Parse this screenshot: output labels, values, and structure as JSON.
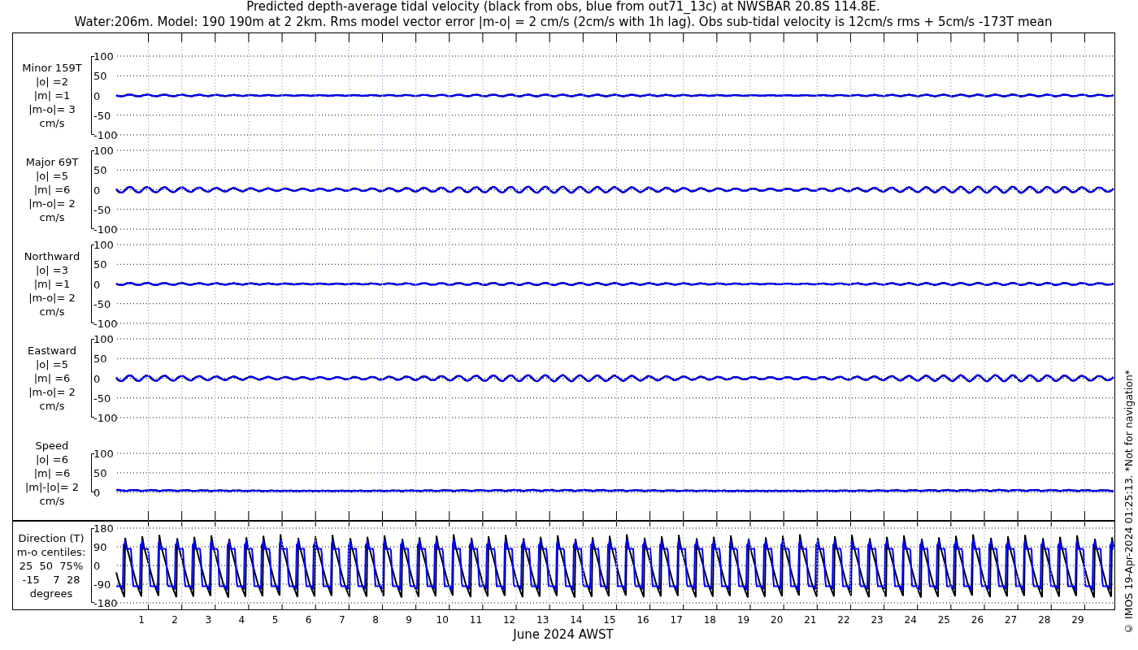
{
  "title": {
    "line_1": "Predicted depth-average tidal velocity (black from obs, blue from out71_13c) at NWSBAR 20.8S 114.8E.",
    "line_2": "Water:206m. Model: 190 190m at 2 2km. Rms model vector error |m-o| = 2 cm/s (2cm/s with 1h lag). Obs sub-tidal velocity is 12cm/s rms + 5cm/s -173T mean"
  },
  "panels": [
    {
      "kind": "velocity",
      "label_lines": [
        "Minor 159T",
        "|o| =2",
        "|m| =1",
        "|m-o|= 3",
        "cm/s"
      ],
      "y_ticks": [
        "100",
        "50",
        "0",
        "-50",
        "-100"
      ]
    },
    {
      "kind": "velocity",
      "label_lines": [
        "Major 69T",
        "|o| =5",
        "|m| =6",
        "|m-o|= 2",
        "cm/s"
      ],
      "y_ticks": [
        "100",
        "50",
        "0",
        "-50",
        "-100"
      ]
    },
    {
      "kind": "velocity",
      "label_lines": [
        "Northward",
        "|o| =3",
        "|m| =1",
        "|m-o|= 2",
        "cm/s"
      ],
      "y_ticks": [
        "100",
        "50",
        "0",
        "-50",
        "-100"
      ]
    },
    {
      "kind": "velocity",
      "label_lines": [
        "Eastward",
        "|o| =5",
        "|m| =6",
        "|m-o|= 2",
        "cm/s"
      ],
      "y_ticks": [
        "100",
        "50",
        "0",
        "-50",
        "-100"
      ]
    },
    {
      "kind": "speed",
      "label_lines": [
        "Speed",
        "|o| =6",
        "|m| =6",
        "|m|-|o|= 2",
        "cm/s"
      ],
      "y_ticks": [
        "100",
        "50",
        "0"
      ]
    },
    {
      "kind": "direction",
      "label_lines": [
        "Direction (T)",
        "m-o centiles:",
        "25  50  75%",
        "-15    7  28",
        "degrees"
      ],
      "y_ticks": [
        "180",
        "90",
        "0",
        "-90",
        "-180"
      ]
    }
  ],
  "x_axis": {
    "day_labels": [
      "1",
      "2",
      "3",
      "4",
      "5",
      "6",
      "7",
      "8",
      "9",
      "10",
      "11",
      "12",
      "13",
      "14",
      "15",
      "16",
      "17",
      "18",
      "19",
      "20",
      "21",
      "22",
      "23",
      "24",
      "25",
      "26",
      "27",
      "28",
      "29"
    ],
    "title": "June 2024 AWST"
  },
  "credit": "© IMOS 19-Apr-2024 01:25:13. *Not for navigation*"
}
